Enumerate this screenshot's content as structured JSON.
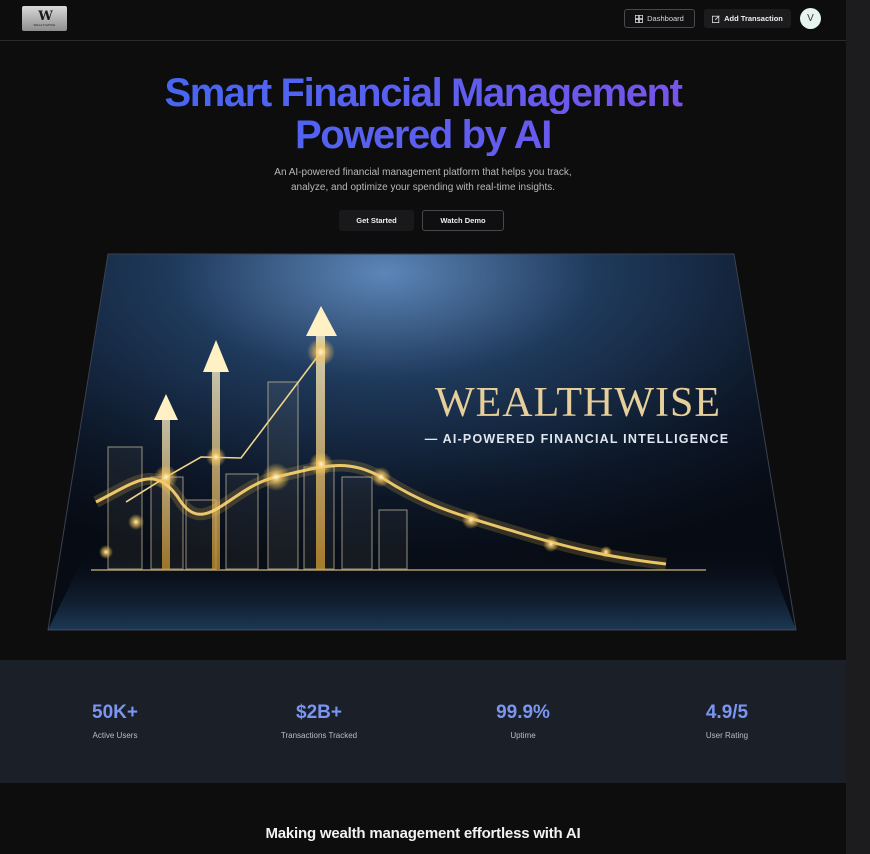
{
  "header": {
    "logo_text": "W",
    "logo_small": "WEALTHWISE",
    "dashboard_label": "Dashboard",
    "add_transaction_label": "Add Transaction",
    "avatar_initial": "V"
  },
  "hero": {
    "title_line1": "Smart Financial Management",
    "title_line2": "Powered by AI",
    "subtitle_line1": "An AI-powered financial management platform that helps you track,",
    "subtitle_line2": "analyze, and optimize your spending with real-time insights.",
    "get_started_label": "Get Started",
    "watch_demo_label": "Watch Demo"
  },
  "hero_image": {
    "brand": "WEALTHWISE",
    "tagline": "— AI-POWERED FINANCIAL INTELLIGENCE"
  },
  "stats": [
    {
      "value": "50K+",
      "label": "Active Users"
    },
    {
      "value": "$2B+",
      "label": "Transactions Tracked"
    },
    {
      "value": "99.9%",
      "label": "Uptime"
    },
    {
      "value": "4.9/5",
      "label": "User Rating"
    }
  ],
  "section": {
    "tagline": "Making wealth management effortless with AI"
  },
  "colors": {
    "accent": "#7b95f2",
    "gradient_start": "#3b6cf0",
    "gradient_end": "#8a4de6",
    "gold": "#e6c27a"
  },
  "icons": {
    "dashboard": "dashboard-icon",
    "add_transaction": "pen-square-icon"
  }
}
